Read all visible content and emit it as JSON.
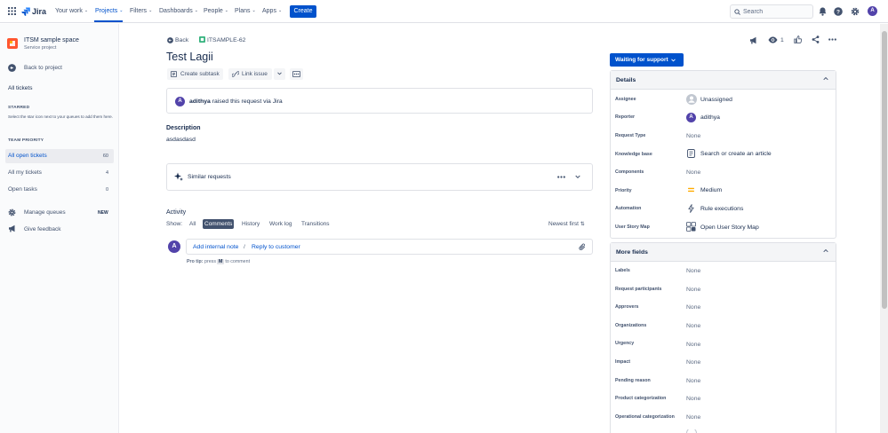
{
  "nav": {
    "logo_text": "Jira",
    "items": [
      {
        "label": "Your work"
      },
      {
        "label": "Projects"
      },
      {
        "label": "Filters"
      },
      {
        "label": "Dashboards"
      },
      {
        "label": "People"
      },
      {
        "label": "Plans"
      },
      {
        "label": "Apps"
      }
    ],
    "create_label": "Create",
    "search_placeholder": "Search"
  },
  "sidebar": {
    "project_name": "ITSM sample space",
    "project_type": "Service project",
    "back_to_project": "Back to project",
    "all_tickets": "All tickets",
    "starred_heading": "STARRED",
    "starred_hint": "Select the star icon next to your queues to add them here.",
    "team_priority_heading": "TEAM PRIORITY",
    "queues": [
      {
        "label": "All open tickets",
        "count": "60"
      },
      {
        "label": "All my tickets",
        "count": "4"
      },
      {
        "label": "Open tasks",
        "count": "0"
      }
    ],
    "manage_queues": "Manage queues",
    "manage_badge": "NEW",
    "give_feedback": "Give feedback"
  },
  "issue": {
    "back_label": "Back",
    "key": "ITSAMPLE-62",
    "title": "Test Lagii",
    "create_subtask": "Create subtask",
    "link_issue": "Link issue",
    "watch_count": "1",
    "requester_avatar": "A",
    "raised_by": "adithya",
    "raised_text": "raised this request via",
    "raised_channel": "Jira",
    "description_heading": "Description",
    "description": "asdasdasd",
    "similar_requests": "Similar requests"
  },
  "activity": {
    "heading": "Activity",
    "show_label": "Show:",
    "tabs": [
      "All",
      "Comments",
      "History",
      "Work log",
      "Transitions"
    ],
    "selected_tab": "Comments",
    "sort_label": "Newest first",
    "user_avatar": "A",
    "add_internal_note": "Add internal note",
    "separator": "/",
    "reply_to_customer": "Reply to customer",
    "pro_tip_prefix": "Pro tip:",
    "pro_tip_press": "press",
    "pro_tip_key": "M",
    "pro_tip_suffix": "to comment"
  },
  "status": {
    "label": "Waiting for support"
  },
  "details": {
    "heading": "Details",
    "fields": [
      {
        "label": "Assignee",
        "value": "Unassigned"
      },
      {
        "label": "Reporter",
        "value": "adithya"
      },
      {
        "label": "Request Type",
        "value": "None"
      },
      {
        "label": "Knowledge base",
        "value": "Search or create an article"
      },
      {
        "label": "Components",
        "value": "None"
      },
      {
        "label": "Priority",
        "value": "Medium"
      },
      {
        "label": "Automation",
        "value": "Rule executions"
      },
      {
        "label": "User Story Map",
        "value": "Open User Story Map"
      }
    ],
    "reporter_avatar": "A"
  },
  "more_fields": {
    "heading": "More fields",
    "fields": [
      {
        "label": "Labels",
        "value": "None"
      },
      {
        "label": "Request participants",
        "value": "None"
      },
      {
        "label": "Approvers",
        "value": "None"
      },
      {
        "label": "Organizations",
        "value": "None"
      },
      {
        "label": "Urgency",
        "value": "None"
      },
      {
        "label": "Impact",
        "value": "None"
      },
      {
        "label": "Pending reason",
        "value": "None"
      },
      {
        "label": "Product categorization",
        "value": "None"
      },
      {
        "label": "Operational categorization",
        "value": "None"
      }
    ]
  },
  "colors": {
    "brand": "#0052cc",
    "priority_medium": "#ffab00",
    "avatar": "#5243aa"
  }
}
